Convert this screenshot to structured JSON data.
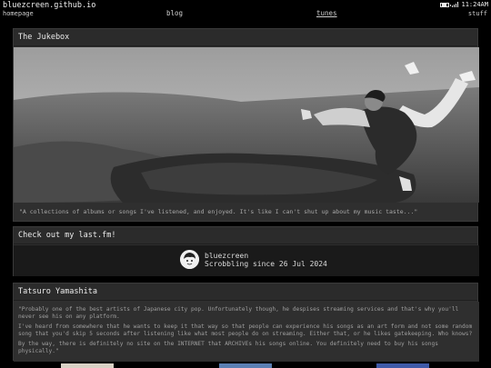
{
  "header": {
    "site_title": "bluezcreen.github.io",
    "home_link": "homepage",
    "nav": {
      "blog": "blog",
      "tunes": "tunes",
      "stuff": "stuff"
    },
    "status": {
      "time": "11:24AM"
    }
  },
  "jukebox": {
    "title": "The Jukebox",
    "caption": "\"A collections of albums or songs I've listened, and enjoyed. It's like I can't shut up about my music taste...\""
  },
  "lastfm": {
    "title": "Check out my last.fm!",
    "username": "bluezcreen",
    "since": "Scrobbling since 26 Jul 2024"
  },
  "tatsuro": {
    "title": "Tatsuro Yamashita",
    "paragraphs": [
      "\"Probably one of the best artists of Japanese city pop. Unfortunately though, he despises streaming services and that's why you'll never see his on any platform.",
      "I've heard from somewhere that he wants to keep it that way so that people can experience his songs as an art form and not some random song that you'd skip 5 seconds after listening like what most people do on streaming. Either that, or he likes gatekeeping. Who knows?",
      "By the way, there is definitely no site on the INTERNET that ARCHIVEs his songs online. You definitely need to buy his songs physically.\""
    ]
  },
  "colors": {
    "background": "#000000",
    "card": "#2f2f2f",
    "text": "#d8d8d8"
  }
}
